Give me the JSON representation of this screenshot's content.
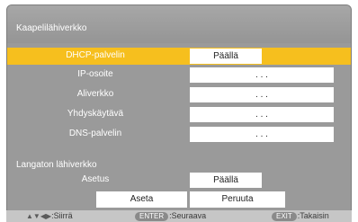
{
  "window": {
    "title": "Kaapelilähiverkko"
  },
  "rows": [
    {
      "label": "DHCP-palvelin",
      "value": "Päällä"
    },
    {
      "label": "IP-osoite",
      "value": ".   .   ."
    },
    {
      "label": "Aliverkko",
      "value": ".   .   ."
    },
    {
      "label": "Yhdyskäytävä",
      "value": ".   .   ."
    },
    {
      "label": "DNS-palvelin",
      "value": ".   .   ."
    }
  ],
  "wireless": {
    "section_label": "Langaton lähiverkko",
    "setting_label": "Asetus",
    "setting_value": "Päällä"
  },
  "buttons": {
    "set": "Aseta",
    "cancel": "Peruuta"
  },
  "footer": {
    "move_arrows": "▲▼◀▶",
    "move_label": ":Siirrä",
    "enter_key": "ENTER",
    "enter_label": ":Seuraava",
    "exit_key": "EXIT",
    "exit_label": ":Takaisin"
  },
  "colors": {
    "selected": "#f6bf1e",
    "panel": "#9a9a9a"
  }
}
